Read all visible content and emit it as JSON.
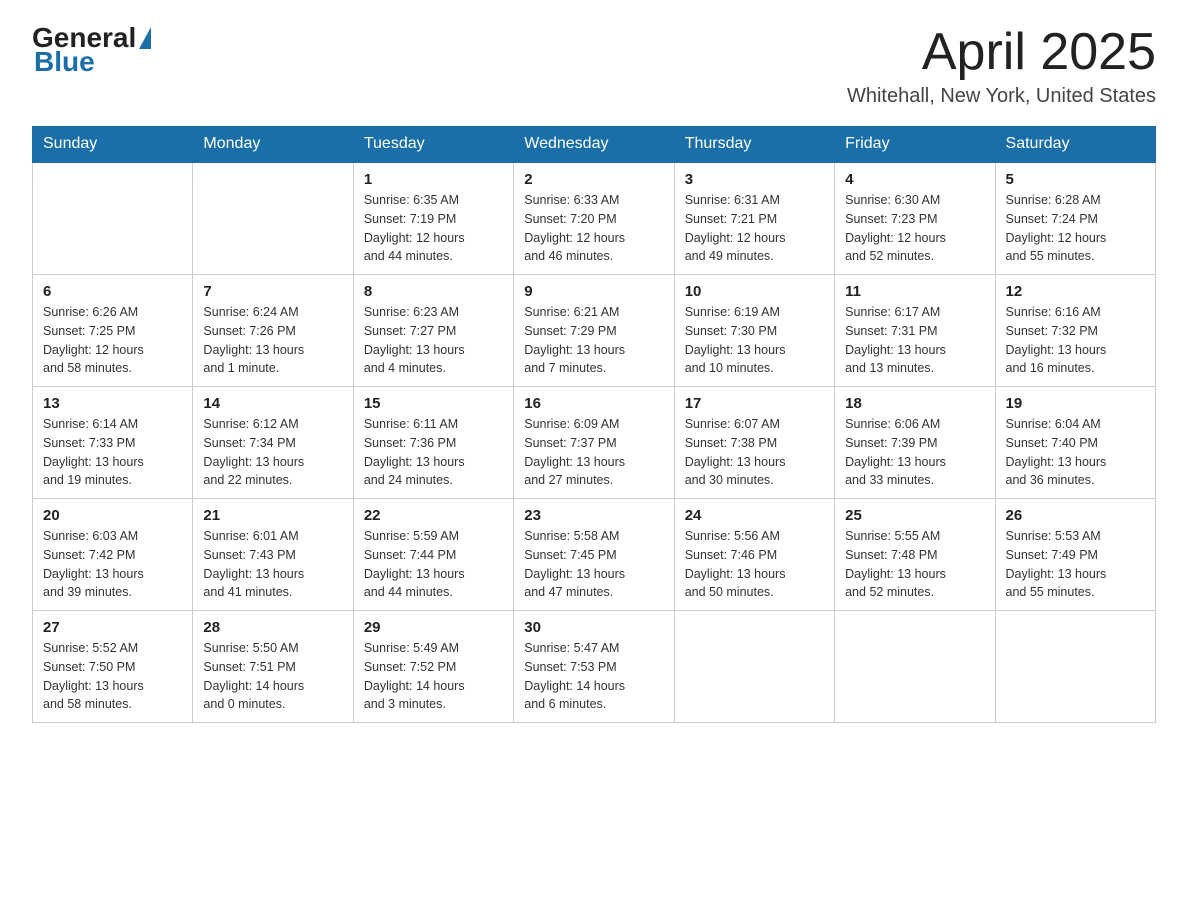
{
  "header": {
    "logo_general": "General",
    "logo_blue": "Blue",
    "month": "April 2025",
    "location": "Whitehall, New York, United States"
  },
  "days_of_week": [
    "Sunday",
    "Monday",
    "Tuesday",
    "Wednesday",
    "Thursday",
    "Friday",
    "Saturday"
  ],
  "weeks": [
    [
      {
        "num": "",
        "info": ""
      },
      {
        "num": "",
        "info": ""
      },
      {
        "num": "1",
        "info": "Sunrise: 6:35 AM\nSunset: 7:19 PM\nDaylight: 12 hours\nand 44 minutes."
      },
      {
        "num": "2",
        "info": "Sunrise: 6:33 AM\nSunset: 7:20 PM\nDaylight: 12 hours\nand 46 minutes."
      },
      {
        "num": "3",
        "info": "Sunrise: 6:31 AM\nSunset: 7:21 PM\nDaylight: 12 hours\nand 49 minutes."
      },
      {
        "num": "4",
        "info": "Sunrise: 6:30 AM\nSunset: 7:23 PM\nDaylight: 12 hours\nand 52 minutes."
      },
      {
        "num": "5",
        "info": "Sunrise: 6:28 AM\nSunset: 7:24 PM\nDaylight: 12 hours\nand 55 minutes."
      }
    ],
    [
      {
        "num": "6",
        "info": "Sunrise: 6:26 AM\nSunset: 7:25 PM\nDaylight: 12 hours\nand 58 minutes."
      },
      {
        "num": "7",
        "info": "Sunrise: 6:24 AM\nSunset: 7:26 PM\nDaylight: 13 hours\nand 1 minute."
      },
      {
        "num": "8",
        "info": "Sunrise: 6:23 AM\nSunset: 7:27 PM\nDaylight: 13 hours\nand 4 minutes."
      },
      {
        "num": "9",
        "info": "Sunrise: 6:21 AM\nSunset: 7:29 PM\nDaylight: 13 hours\nand 7 minutes."
      },
      {
        "num": "10",
        "info": "Sunrise: 6:19 AM\nSunset: 7:30 PM\nDaylight: 13 hours\nand 10 minutes."
      },
      {
        "num": "11",
        "info": "Sunrise: 6:17 AM\nSunset: 7:31 PM\nDaylight: 13 hours\nand 13 minutes."
      },
      {
        "num": "12",
        "info": "Sunrise: 6:16 AM\nSunset: 7:32 PM\nDaylight: 13 hours\nand 16 minutes."
      }
    ],
    [
      {
        "num": "13",
        "info": "Sunrise: 6:14 AM\nSunset: 7:33 PM\nDaylight: 13 hours\nand 19 minutes."
      },
      {
        "num": "14",
        "info": "Sunrise: 6:12 AM\nSunset: 7:34 PM\nDaylight: 13 hours\nand 22 minutes."
      },
      {
        "num": "15",
        "info": "Sunrise: 6:11 AM\nSunset: 7:36 PM\nDaylight: 13 hours\nand 24 minutes."
      },
      {
        "num": "16",
        "info": "Sunrise: 6:09 AM\nSunset: 7:37 PM\nDaylight: 13 hours\nand 27 minutes."
      },
      {
        "num": "17",
        "info": "Sunrise: 6:07 AM\nSunset: 7:38 PM\nDaylight: 13 hours\nand 30 minutes."
      },
      {
        "num": "18",
        "info": "Sunrise: 6:06 AM\nSunset: 7:39 PM\nDaylight: 13 hours\nand 33 minutes."
      },
      {
        "num": "19",
        "info": "Sunrise: 6:04 AM\nSunset: 7:40 PM\nDaylight: 13 hours\nand 36 minutes."
      }
    ],
    [
      {
        "num": "20",
        "info": "Sunrise: 6:03 AM\nSunset: 7:42 PM\nDaylight: 13 hours\nand 39 minutes."
      },
      {
        "num": "21",
        "info": "Sunrise: 6:01 AM\nSunset: 7:43 PM\nDaylight: 13 hours\nand 41 minutes."
      },
      {
        "num": "22",
        "info": "Sunrise: 5:59 AM\nSunset: 7:44 PM\nDaylight: 13 hours\nand 44 minutes."
      },
      {
        "num": "23",
        "info": "Sunrise: 5:58 AM\nSunset: 7:45 PM\nDaylight: 13 hours\nand 47 minutes."
      },
      {
        "num": "24",
        "info": "Sunrise: 5:56 AM\nSunset: 7:46 PM\nDaylight: 13 hours\nand 50 minutes."
      },
      {
        "num": "25",
        "info": "Sunrise: 5:55 AM\nSunset: 7:48 PM\nDaylight: 13 hours\nand 52 minutes."
      },
      {
        "num": "26",
        "info": "Sunrise: 5:53 AM\nSunset: 7:49 PM\nDaylight: 13 hours\nand 55 minutes."
      }
    ],
    [
      {
        "num": "27",
        "info": "Sunrise: 5:52 AM\nSunset: 7:50 PM\nDaylight: 13 hours\nand 58 minutes."
      },
      {
        "num": "28",
        "info": "Sunrise: 5:50 AM\nSunset: 7:51 PM\nDaylight: 14 hours\nand 0 minutes."
      },
      {
        "num": "29",
        "info": "Sunrise: 5:49 AM\nSunset: 7:52 PM\nDaylight: 14 hours\nand 3 minutes."
      },
      {
        "num": "30",
        "info": "Sunrise: 5:47 AM\nSunset: 7:53 PM\nDaylight: 14 hours\nand 6 minutes."
      },
      {
        "num": "",
        "info": ""
      },
      {
        "num": "",
        "info": ""
      },
      {
        "num": "",
        "info": ""
      }
    ]
  ]
}
